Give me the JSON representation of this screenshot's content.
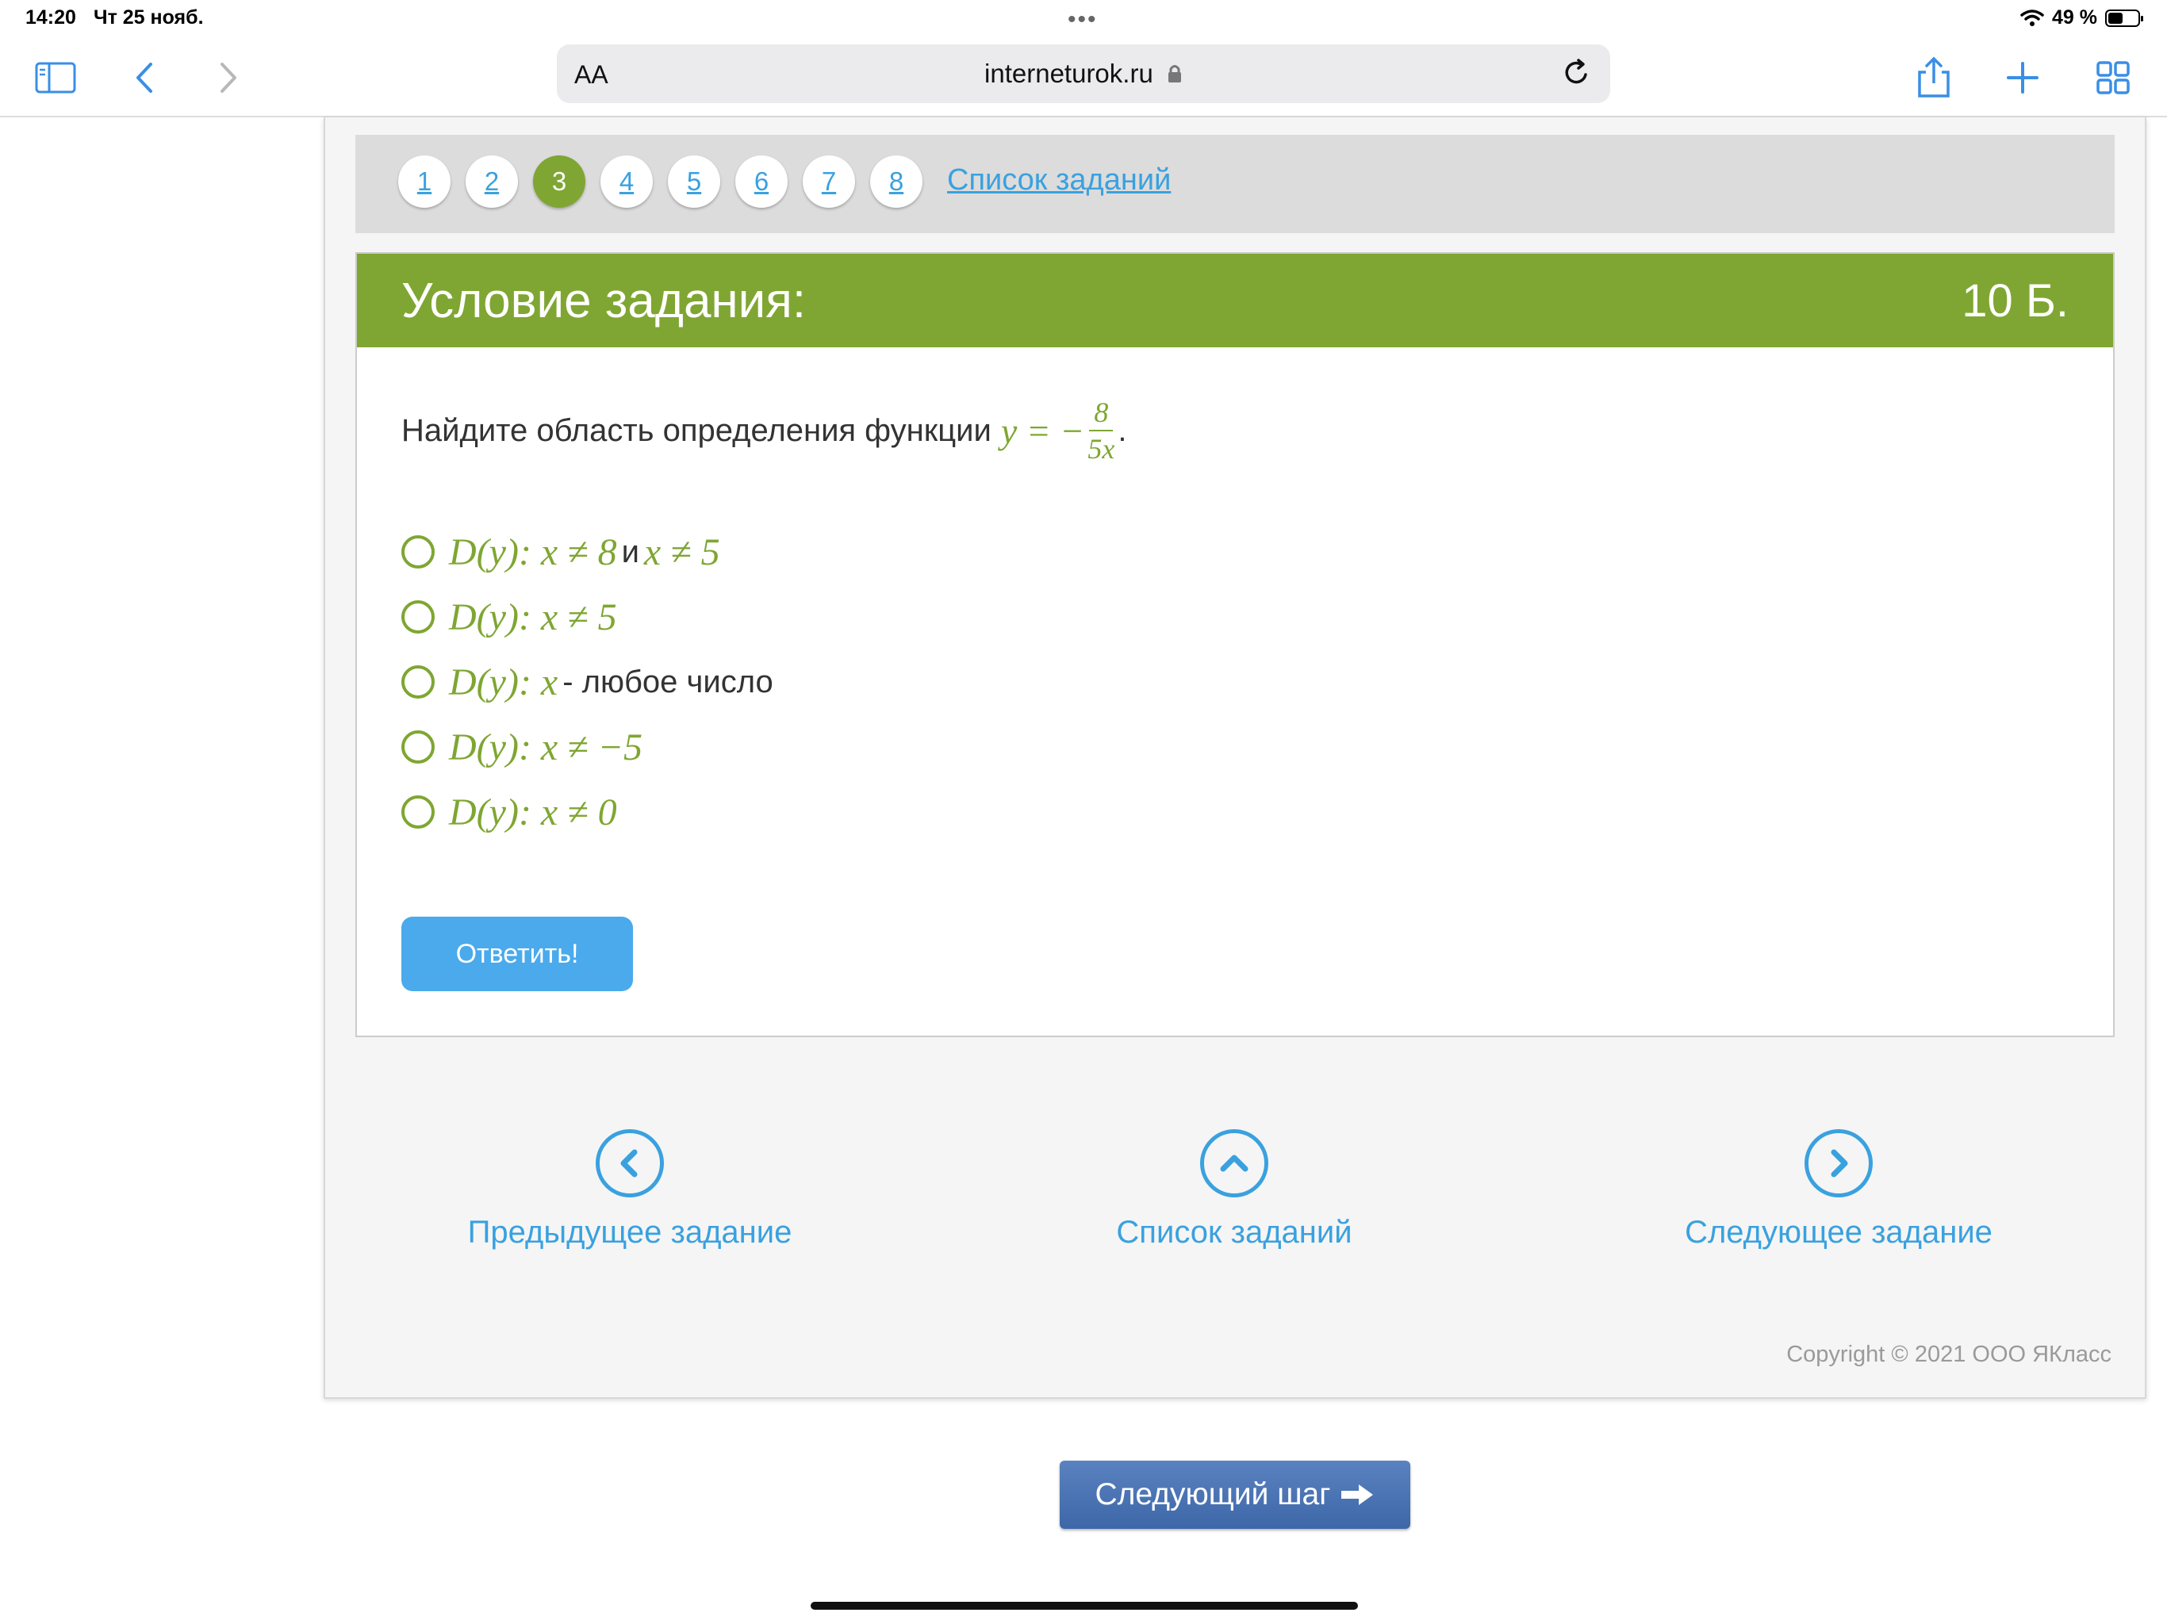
{
  "status_bar": {
    "time": "14:20",
    "date": "Чт 25 нояб.",
    "dots": "•••",
    "battery": "49 %",
    "battery_level": 0.49
  },
  "browser": {
    "aa_label": "AA",
    "url": "interneturok.ru",
    "icons": [
      "sidebar-icon",
      "back-icon",
      "forward-icon",
      "lock-icon",
      "reload-icon",
      "share-icon",
      "plus-icon",
      "tabs-icon"
    ]
  },
  "pager": {
    "numbers": [
      "1",
      "2",
      "3",
      "4",
      "5",
      "6",
      "7",
      "8"
    ],
    "active": "3",
    "list_label": "Список заданий"
  },
  "task": {
    "title": "Условие задания:",
    "points": "10 Б.",
    "question_text": "Найдите область определения функции",
    "formula_lhs": "y = −",
    "formula_num": "8",
    "formula_den": "5x",
    "formula_end": ".",
    "options": [
      {
        "math1": "D(y): x ≠ 8",
        "text": "и",
        "math2": "x ≠ 5"
      },
      {
        "math1": "D(y): x ≠ 5",
        "text": "",
        "math2": ""
      },
      {
        "math1": "D(y): x",
        "text": "- любое число",
        "math2": ""
      },
      {
        "math1": "D(y): x ≠ −5",
        "text": "",
        "math2": ""
      },
      {
        "math1": "D(y): x ≠ 0",
        "text": "",
        "math2": ""
      }
    ],
    "answer_button": "Ответить!"
  },
  "navigation": {
    "prev": "Предыдущее задание",
    "list": "Список заданий",
    "next": "Следующее задание"
  },
  "copyright": "Copyright © 2021 ООО ЯКласс",
  "next_step": "Следующий шаг",
  "colors": {
    "green": "#7fa632",
    "blue": "#3aa1df",
    "button_blue": "#4aaaec",
    "next_step": "#4a72b4"
  }
}
